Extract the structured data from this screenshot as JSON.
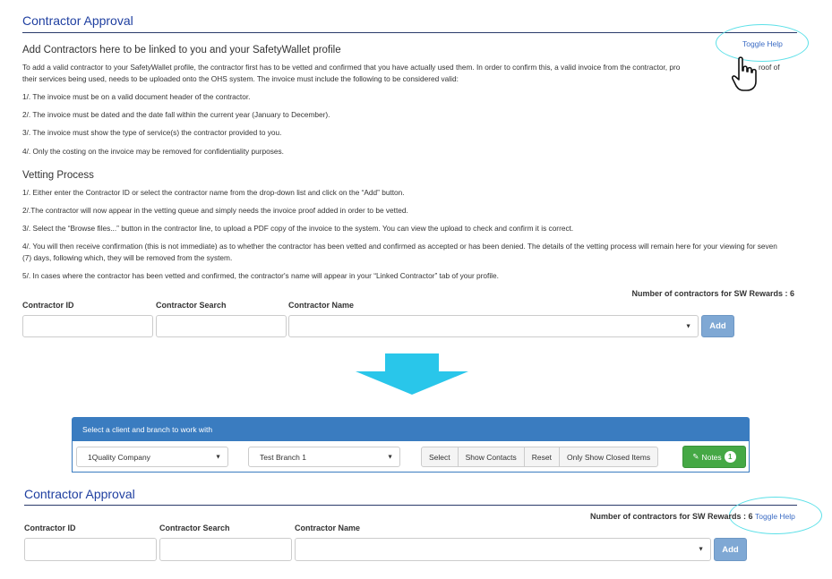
{
  "top": {
    "title": "Contractor Approval",
    "toggle_help": "Toggle Help",
    "intro_heading": "Add Contractors here to be linked to you and your SafetyWallet profile",
    "intro_line1": "To add a valid contractor to your SafetyWallet profile, the contractor first has to be vetted and confirmed that you have actually used them. In order to confirm this, a valid invoice from the contractor, pro",
    "intro_line1_tail": "roof of",
    "intro_line2": "their services being used, needs to be uploaded onto the OHS system. The invoice must include the following to be considered valid:",
    "rules": [
      "1/. The invoice must be on a valid document header of the contractor.",
      "2/. The invoice must be dated and the date fall within the current year (January to December).",
      "3/. The invoice must show the type of service(s) the contractor provided to you.",
      "4/. Only the costing on the invoice may be removed for confidentiality purposes."
    ],
    "vetting_heading": "Vetting Process",
    "vetting": [
      "1/. Either enter the Contractor ID or select the contractor name from the drop-down list and click on the “Add” button.",
      "2/.The contractor will now appear in the vetting queue and simply needs the invoice proof added in order to be vetted.",
      "3/. Select the “Browse files...” button in the contractor line, to upload a PDF copy of the invoice to the system. You can view the upload to check and confirm it is correct.",
      "4/. You will then receive confirmation (this is not immediate) as to whether the contractor has been vetted and confirmed as accepted or has been denied. The details of the vetting process will remain here for your viewing for seven (7) days, following which, they will be removed from the system.",
      "5/. In cases where the contractor has been vetted and confirmed, the contractor's name will appear in your “Linked Contractor” tab of your profile."
    ],
    "count_label": "Number of contractors for SW Rewards : 6",
    "contractor_id_label": "Contractor ID",
    "contractor_search_label": "Contractor Search",
    "contractor_name_label": "Contractor Name",
    "add_label": "Add"
  },
  "panel": {
    "header": "Select a client and branch to work with",
    "client": "1Quality Company",
    "branch": "Test Branch 1",
    "buttons": [
      "Select",
      "Show Contacts",
      "Reset",
      "Only Show Closed Items"
    ],
    "notes_label": "Notes",
    "notes_count": "1"
  },
  "bottom": {
    "title": "Contractor Approval",
    "count_label": "Number of contractors for SW Rewards : 6",
    "toggle_help": "Toggle Help",
    "contractor_id_label": "Contractor ID",
    "contractor_search_label": "Contractor Search",
    "contractor_name_label": "Contractor Name",
    "add_label": "Add"
  },
  "icons": {
    "pointer": "hand-pointer-icon",
    "arrow": "down-arrow-icon",
    "pencil": "pencil-icon"
  },
  "colors": {
    "title": "#1f3fa0",
    "highlight": "#5ce0e8",
    "panel_header": "#3a7cc0",
    "add_button": "#7fa8d4",
    "notes_button": "#45a845",
    "arrow": "#29c6ea"
  }
}
